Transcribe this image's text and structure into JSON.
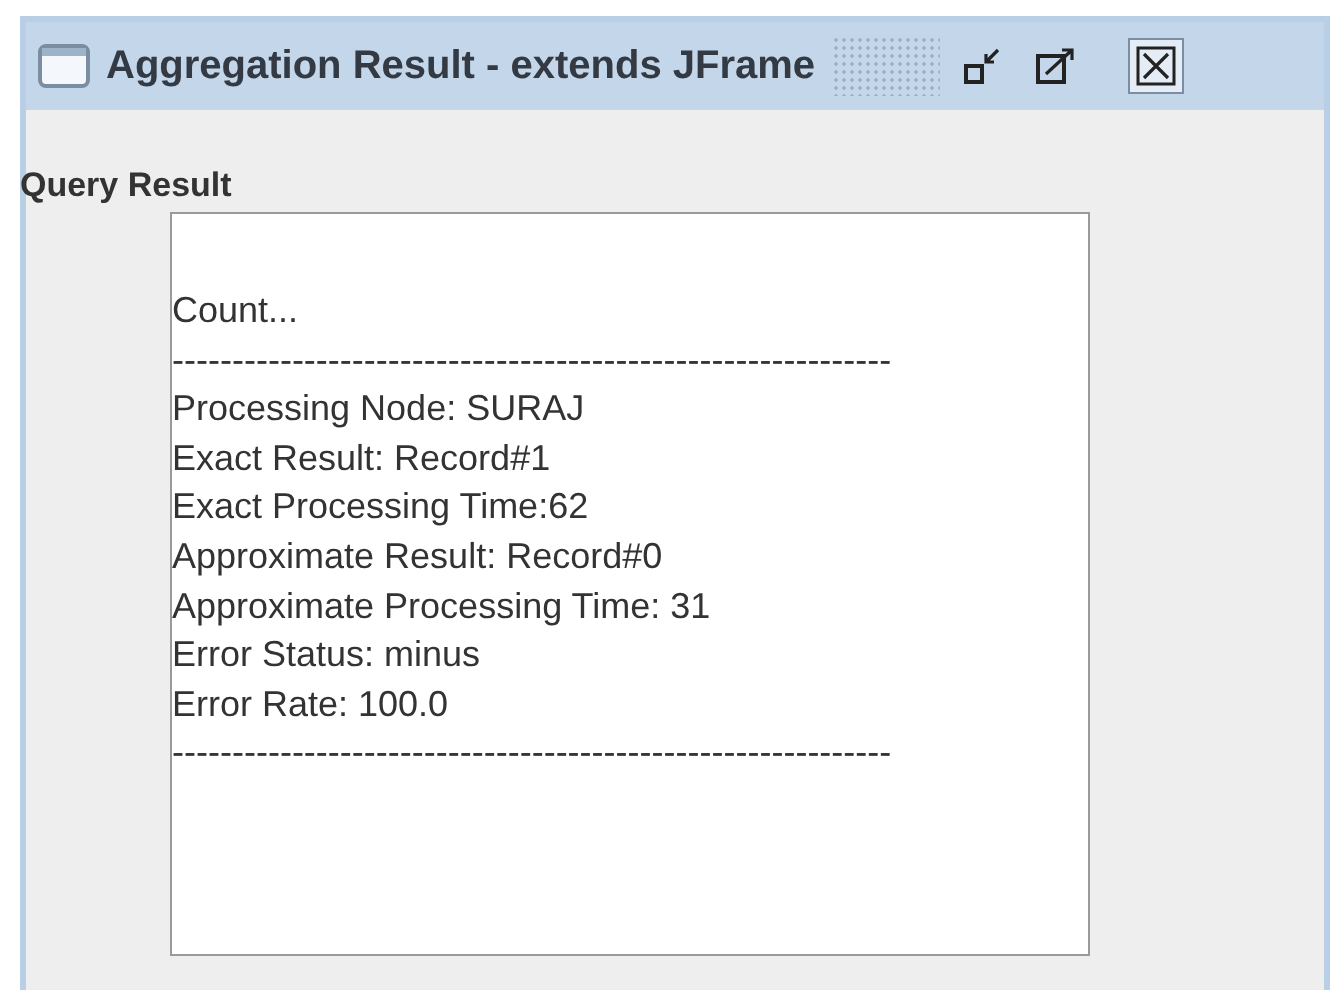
{
  "window": {
    "title": "Aggregation Result - extends JFrame"
  },
  "label": "Query Result",
  "result_lines": [
    "Count...",
    "------------------------------------------------------------",
    "Processing Node: SURAJ",
    "Exact Result: Record#1",
    "Exact Processing Time:62",
    "Approximate Result: Record#0",
    "Approximate Processing Time: 31",
    "Error Status: minus",
    "Error Rate: 100.0",
    "------------------------------------------------------------"
  ]
}
